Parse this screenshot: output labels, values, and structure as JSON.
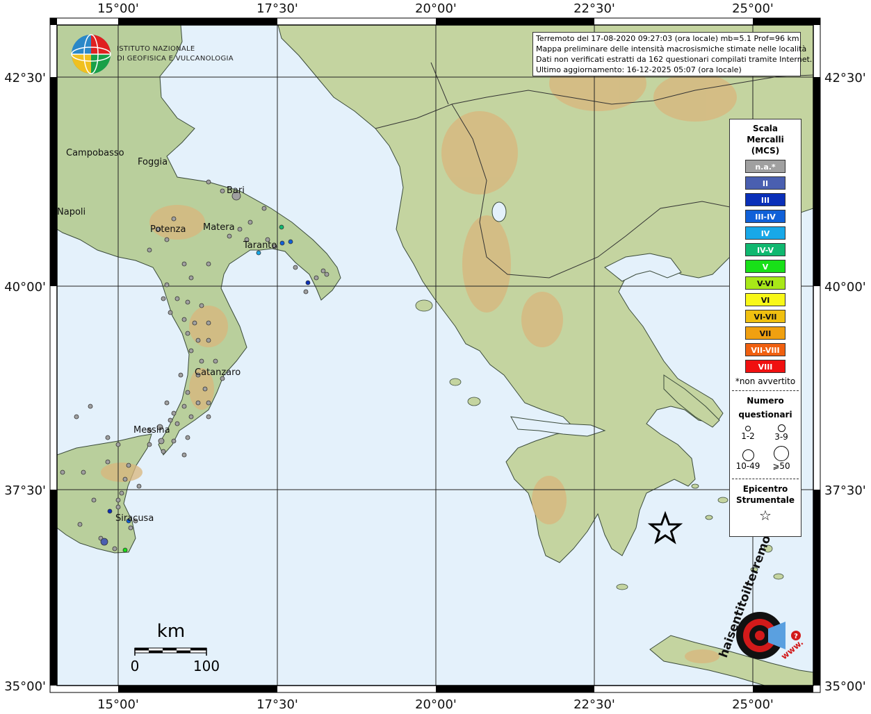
{
  "info": {
    "line1": "Terremoto del 17-08-2020 09:27:03 (ora locale) mb=5.1 Prof=96 km",
    "line2": "Mappa preliminare delle intensità macrosismiche stimate nelle località",
    "line3": "Dati non verificati estratti da 162 questionari compilati tramite Internet.",
    "line4": "Ultimo aggiornamento: 16-12-2025 05:07 (ora locale)"
  },
  "logo": {
    "line1": "ISTITUTO NAZIONALE",
    "line2": "DI GEOFISICA E VULCANOLOGIA"
  },
  "axes": {
    "lon_labels": [
      "15°00'",
      "17°30'",
      "20°00'",
      "22°30'",
      "25°00'"
    ],
    "lat_labels": [
      "42°30'",
      "40°00'",
      "37°30'",
      "35°00'"
    ]
  },
  "cities": [
    "Campobasso",
    "Foggia",
    "Bari",
    "Napoli",
    "Potenza",
    "Matera",
    "Taranto",
    "Catanzaro",
    "Messina",
    "Siracusa"
  ],
  "scale_bar": {
    "unit": "km",
    "min": "0",
    "max": "100"
  },
  "legend": {
    "title": "Scala Mercalli (MCS)",
    "title_lines": [
      "Scala",
      "Mercalli",
      "(MCS)"
    ],
    "items": [
      {
        "label": "n.a.*",
        "color": "#a0a0a0"
      },
      {
        "label": "II",
        "color": "#4a5fb0"
      },
      {
        "label": "III",
        "color": "#0a2fb8"
      },
      {
        "label": "III-IV",
        "color": "#1060d8"
      },
      {
        "label": "IV",
        "color": "#18a8e8"
      },
      {
        "label": "IV-V",
        "color": "#10b870"
      },
      {
        "label": "V",
        "color": "#18e018"
      },
      {
        "label": "V-VI",
        "color": "#a8e818"
      },
      {
        "label": "VI",
        "color": "#f8f818"
      },
      {
        "label": "VI-VII",
        "color": "#f0c010"
      },
      {
        "label": "VII",
        "color": "#f0a010"
      },
      {
        "label": "VII-VIII",
        "color": "#f06010"
      },
      {
        "label": "VIII",
        "color": "#f01010"
      }
    ],
    "na_note": "*non avvertito",
    "q_title_lines": [
      "Numero",
      "questionari"
    ],
    "q_items": [
      "1-2",
      "3-9",
      "10-49",
      "⩾50"
    ],
    "epi_title_lines": [
      "Epicentro",
      "Strumentale"
    ],
    "epi_symbol": "☆"
  },
  "watermark": {
    "text": "haisentitoilterremoto.it",
    "www": "www."
  }
}
